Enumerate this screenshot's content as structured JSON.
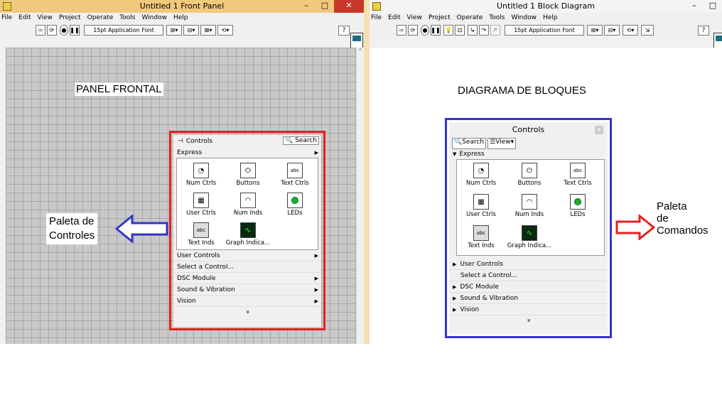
{
  "front_panel": {
    "title": "Untitled 1 Front Panel",
    "menu": [
      "File",
      "Edit",
      "View",
      "Project",
      "Operate",
      "Tools",
      "Window",
      "Help"
    ],
    "toolbar": {
      "font": "15pt Application Font"
    },
    "help_icon": "?"
  },
  "block_diagram": {
    "title": "Untitled 1 Block Diagram",
    "menu": [
      "File",
      "Edit",
      "View",
      "Project",
      "Operate",
      "Tools",
      "Window",
      "Help"
    ],
    "toolbar": {
      "font": "15pt Application Font"
    }
  },
  "window_buttons": {
    "minimize": "–",
    "maximize": "□",
    "close": "✕"
  },
  "annotations": {
    "panel_frontal": "PANEL FRONTAL",
    "diagrama": "DIAGRAMA DE BLOQUES",
    "paleta_controles_l1": "Paleta de",
    "paleta_controles_l2": "Controles",
    "paleta_comandos_l1": "Paleta",
    "paleta_comandos_l2": "de",
    "paleta_comandos_l3": "Comandos"
  },
  "controls_palette": {
    "title": "Controls",
    "search": "Search",
    "express": "Express",
    "icons": [
      "Num Ctrls",
      "Buttons",
      "Text Ctrls",
      "User Ctrls",
      "Num Inds",
      "LEDs",
      "Text Inds",
      "Graph Indica..."
    ],
    "items": [
      "User Controls",
      "Select a Control...",
      "DSC Module",
      "Sound & Vibration",
      "Vision"
    ],
    "more": "»"
  },
  "bd_palette": {
    "title": "Controls",
    "search": "Search",
    "view": "View",
    "express": "Express",
    "icons": [
      "Num Ctrls",
      "Buttons",
      "Text Ctrls",
      "User Ctrls",
      "Num Inds",
      "LEDs",
      "Text Inds",
      "Graph Indica..."
    ],
    "items": [
      "User Controls",
      "Select a Control...",
      "DSC Module",
      "Sound & Vibration",
      "Vision"
    ],
    "more": "»",
    "close": "x"
  },
  "colors": {
    "red_frame": "#e81f1f",
    "blue_frame": "#3535c9",
    "arrow_blue": "#3535c9",
    "arrow_red": "#e81f1f"
  },
  "icon_names": {
    "num_ctrls": "knob-icon",
    "buttons": "toggle-switch-icon",
    "text_ctrls": "string-control-icon",
    "user_ctrls": "user-controls-icon",
    "num_inds": "gauge-icon",
    "leds": "led-icon",
    "text_inds": "string-indicator-icon",
    "graph": "waveform-graph-icon"
  }
}
